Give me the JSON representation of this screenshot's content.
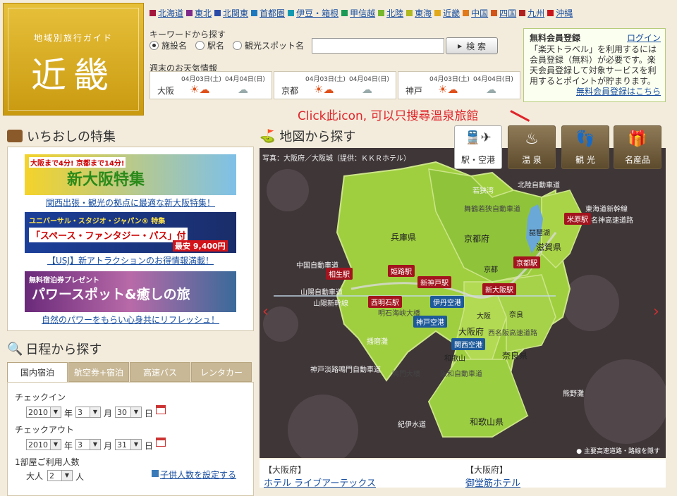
{
  "logo": {
    "subtitle": "地域別旅行ガイド",
    "title": "近畿"
  },
  "regions": [
    {
      "label": "北海道",
      "color": "#a4163c"
    },
    {
      "label": "東北",
      "color": "#7e2a8a"
    },
    {
      "label": "北関東",
      "color": "#2a4aa8"
    },
    {
      "label": "首都圏",
      "color": "#1c79c0"
    },
    {
      "label": "伊豆・箱根",
      "color": "#149ab0"
    },
    {
      "label": "甲信越",
      "color": "#1a9a55"
    },
    {
      "label": "北陸",
      "color": "#77b82e"
    },
    {
      "label": "東海",
      "color": "#b0b822"
    },
    {
      "label": "近畿",
      "color": "#e0a81a"
    },
    {
      "label": "中国",
      "color": "#e07a1a"
    },
    {
      "label": "四国",
      "color": "#d25418"
    },
    {
      "label": "九州",
      "color": "#b02020"
    },
    {
      "label": "沖縄",
      "color": "#c8141a"
    }
  ],
  "keyword": {
    "title": "キーワードから探す",
    "options": [
      "施設名",
      "駅名",
      "観光スポット名"
    ],
    "selected": "施設名",
    "input_value": "",
    "button": "検 索"
  },
  "weather": {
    "title": "週末のお天気情報",
    "cities": [
      {
        "name": "大阪",
        "d1": "04月03日(土)",
        "d2": "04月04日(日)"
      },
      {
        "name": "京都",
        "d1": "04月03日(土)",
        "d2": "04月04日(日)"
      },
      {
        "name": "神戸",
        "d1": "04月03日(土)",
        "d2": "04月04日(日)"
      }
    ]
  },
  "member": {
    "title": "無料会員登録",
    "login": "ログイン",
    "body": "「楽天トラベル」を利用するには会員登録（無料）が必要です。楽天会員登録して対象サービスを利用するとポイントが貯まります。",
    "register_link": "無料会員登録はこちら"
  },
  "annotation": "Click此icon, 可以只搜尋溫泉旅館",
  "pickup": {
    "title": "いちおしの特集",
    "banners": [
      {
        "top": "大阪まで4分! 京都まで14分!",
        "main": "新大阪特集",
        "caption": "関西出張・観光の拠点に最適な新大阪特集！"
      },
      {
        "top": "ユニバーサル・スタジオ・ジャパン® 特集",
        "main": "「スペース・ファンタジー・パス」付",
        "price": "最安 9,400円",
        "caption": "【USJ】新アトラクションのお得情報満載！"
      },
      {
        "top": "無料宿泊券プレゼント",
        "main": "パワースポット&癒しの旅",
        "caption": "自然のパワーをもらい心身共にリフレッシュ！"
      }
    ]
  },
  "schedule": {
    "title": "日程から探す",
    "tabs": [
      "国内宿泊",
      "航空券+宿泊",
      "高速バス",
      "レンタカー"
    ],
    "active_tab": "国内宿泊",
    "checkin_label": "チェックイン",
    "checkout_label": "チェックアウト",
    "checkin": {
      "year": "2010",
      "month": "3",
      "day": "30"
    },
    "checkout": {
      "year": "2010",
      "month": "3",
      "day": "31"
    },
    "unit_year": "年",
    "unit_month": "月",
    "unit_day": "日",
    "rooms_label": "1部屋ご利用人数",
    "adults_label": "大人",
    "adults": "2",
    "adults_unit": "人",
    "children_link": "子供人数を設定する"
  },
  "map": {
    "title": "地図から探す",
    "categories": [
      {
        "label": "駅・空港",
        "icon": "🚆✈"
      },
      {
        "label": "温 泉",
        "icon": "♨"
      },
      {
        "label": "観 光",
        "icon": "👣"
      },
      {
        "label": "名産品",
        "icon": "🎁"
      }
    ],
    "active_category": "駅・空港",
    "photo_credit": "写真：大阪府／大阪城（提供：ＫＫＲホテル）",
    "prefectures": [
      "兵庫県",
      "京都府",
      "滋賀県",
      "大阪府",
      "奈良県",
      "和歌山県"
    ],
    "places": [
      "若狭湾",
      "北陸自動車道",
      "東海道新幹線",
      "名神高速道路",
      "舞鶴若狭自動車道",
      "琵琶湖",
      "京都",
      "大阪",
      "奈良",
      "中国自動車道",
      "山陽自動車道",
      "山陽新幹線",
      "明石海峡大橋",
      "西名阪高速道路",
      "神戸淡路鳴門自動車道",
      "鳴門大橋",
      "和歌山",
      "阪和自動車道",
      "紀伊水道",
      "熊野灘",
      "播磨灘"
    ],
    "stations": [
      "米原駅",
      "京都駅",
      "姫路駅",
      "相生駅",
      "新神戸駅",
      "新大阪駅",
      "西明石駅"
    ],
    "airports": [
      "伊丹空港",
      "神戸空港",
      "関西空港"
    ],
    "toggle_note": "主要高速道路・路線を隠す"
  },
  "hotels": [
    {
      "area": "【大阪府】",
      "name": "ホテル ライブアーテックス"
    },
    {
      "area": "【大阪府】",
      "name": "御堂筋ホテル"
    }
  ]
}
